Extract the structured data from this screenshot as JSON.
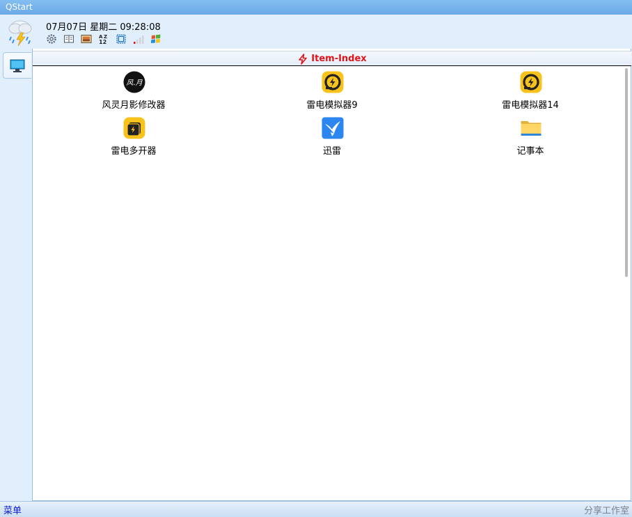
{
  "window": {
    "title": "QStart"
  },
  "header": {
    "datetime": "07月07日 星期二 09:28:08",
    "toolbar": [
      {
        "name": "settings-icon"
      },
      {
        "name": "book-icon"
      },
      {
        "name": "picture-icon"
      },
      {
        "name": "sort-az-icon"
      },
      {
        "name": "screen-select-icon"
      },
      {
        "name": "signal-bars-icon"
      },
      {
        "name": "windows-logo-icon"
      }
    ]
  },
  "sidebar": {
    "tabs": [
      {
        "name": "desktop-monitor-icon"
      }
    ]
  },
  "section": {
    "title": "Item-Index",
    "accent": "#e0151c"
  },
  "items": [
    {
      "label": "风灵月影修改器",
      "icon": "fengling-app-icon"
    },
    {
      "label": "雷电模拟器9",
      "icon": "ldplayer-icon"
    },
    {
      "label": "雷电模拟器14",
      "icon": "ldplayer-icon"
    },
    {
      "label": "雷电多开器",
      "icon": "ld-multi-icon"
    },
    {
      "label": "迅雷",
      "icon": "thunder-bird-icon"
    },
    {
      "label": "记事本",
      "icon": "folder-icon"
    }
  ],
  "statusbar": {
    "menu": "菜单",
    "studio": "分享工作室"
  }
}
